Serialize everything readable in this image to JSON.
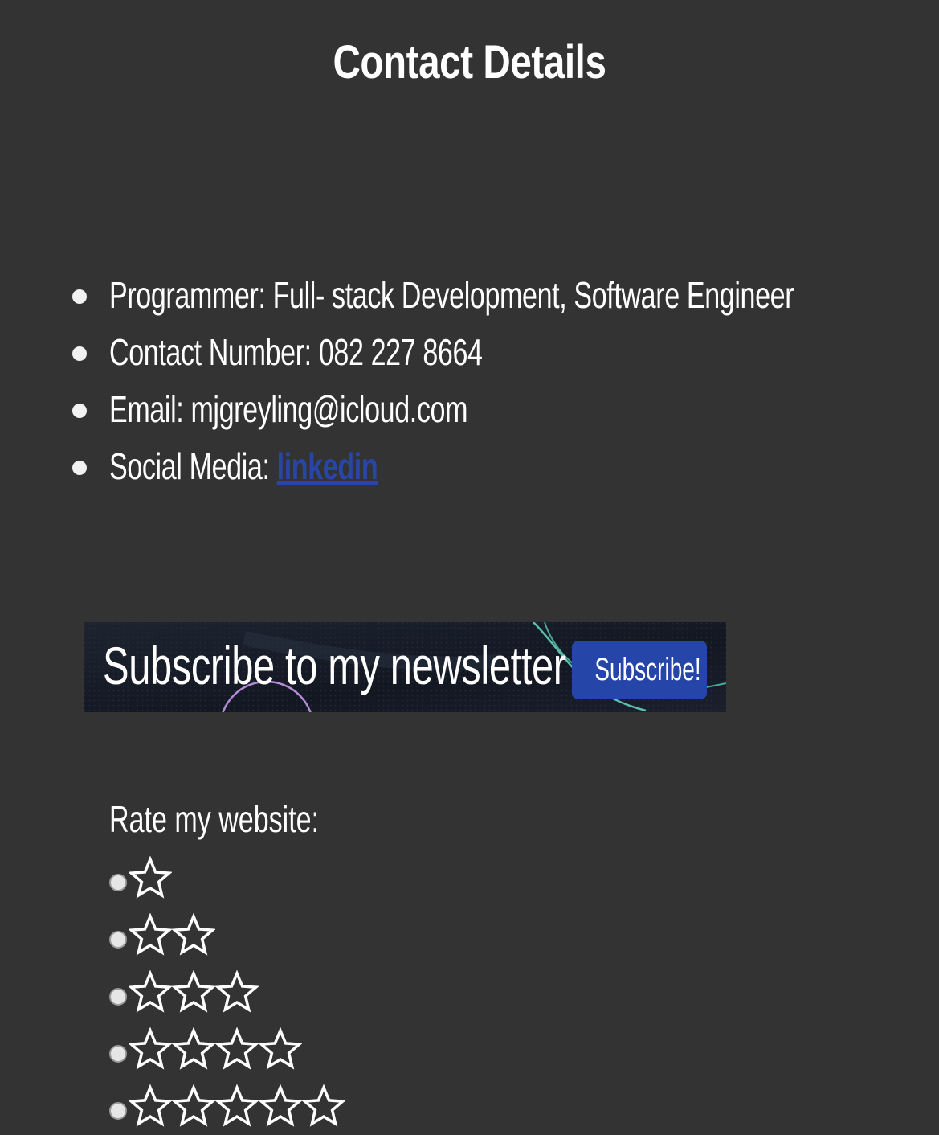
{
  "page": {
    "title": "Contact Details"
  },
  "details": {
    "items": [
      {
        "text": "Programmer: Full- stack Development, Software Engineer"
      },
      {
        "text": "Contact Number: 082 227 8664"
      },
      {
        "text": "Email: mjgreyling@icloud.com"
      },
      {
        "text": "Social Media: ",
        "link_text": "linkedin"
      }
    ]
  },
  "newsletter": {
    "text": "Subscribe to my newsletter",
    "button_label": "Subscribe!"
  },
  "rating": {
    "label": "Rate my website:",
    "options": [
      {
        "stars": 1,
        "icon": "star-outline-icon"
      },
      {
        "stars": 2,
        "icon": "star-outline-icon"
      },
      {
        "stars": 3,
        "icon": "star-outline-icon"
      },
      {
        "stars": 4,
        "icon": "star-outline-icon"
      },
      {
        "stars": 5,
        "icon": "star-outline-icon"
      }
    ]
  },
  "colors": {
    "background": "#333333",
    "text": "#ffffff",
    "link": "#2846a8",
    "button": "#2546a8",
    "banner": "#151a22"
  }
}
